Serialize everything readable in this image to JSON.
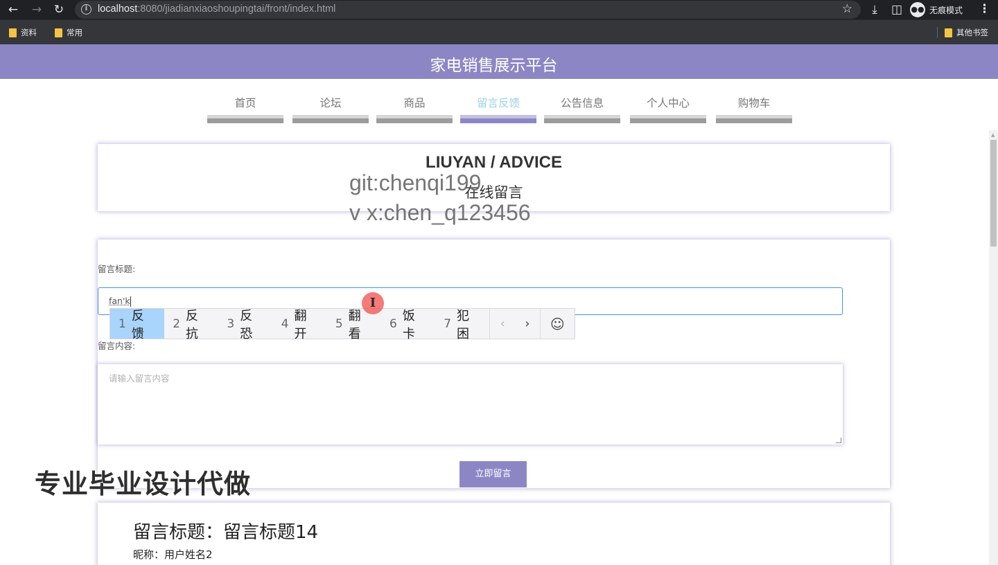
{
  "browser": {
    "url_host": "localhost",
    "url_path": ":8080/jiadianxiaoshoupingtai/front/index.html",
    "incognito_label": "无痕模式",
    "bookmarks": [
      "资料",
      "常用"
    ],
    "other_bookmarks": "其他书签"
  },
  "site": {
    "title": "家电销售展示平台",
    "nav": [
      "首页",
      "论坛",
      "商品",
      "留言反馈",
      "公告信息",
      "个人中心",
      "购物车"
    ],
    "active_nav": "留言反馈"
  },
  "section": {
    "title": "LIUYAN / ADVICE",
    "subtitle": "在线留言"
  },
  "watermark": {
    "line1": "git:chenqi199",
    "line2": "v x:chen_q123456",
    "overlay": "专业毕业设计代做"
  },
  "form": {
    "title_label": "留言标题:",
    "title_value": "fan'k",
    "content_label": "留言内容:",
    "content_placeholder": "请输入留言内容",
    "submit_label": "立即留言"
  },
  "ime": {
    "candidates": [
      {
        "num": "1",
        "text": "反馈"
      },
      {
        "num": "2",
        "text": "反抗"
      },
      {
        "num": "3",
        "text": "反恐"
      },
      {
        "num": "4",
        "text": "翻开"
      },
      {
        "num": "5",
        "text": "翻看"
      },
      {
        "num": "6",
        "text": "饭卡"
      },
      {
        "num": "7",
        "text": "犯困"
      }
    ],
    "selected_index": 0
  },
  "message": {
    "title": "留言标题：留言标题14",
    "author": "昵称：用户姓名2"
  }
}
